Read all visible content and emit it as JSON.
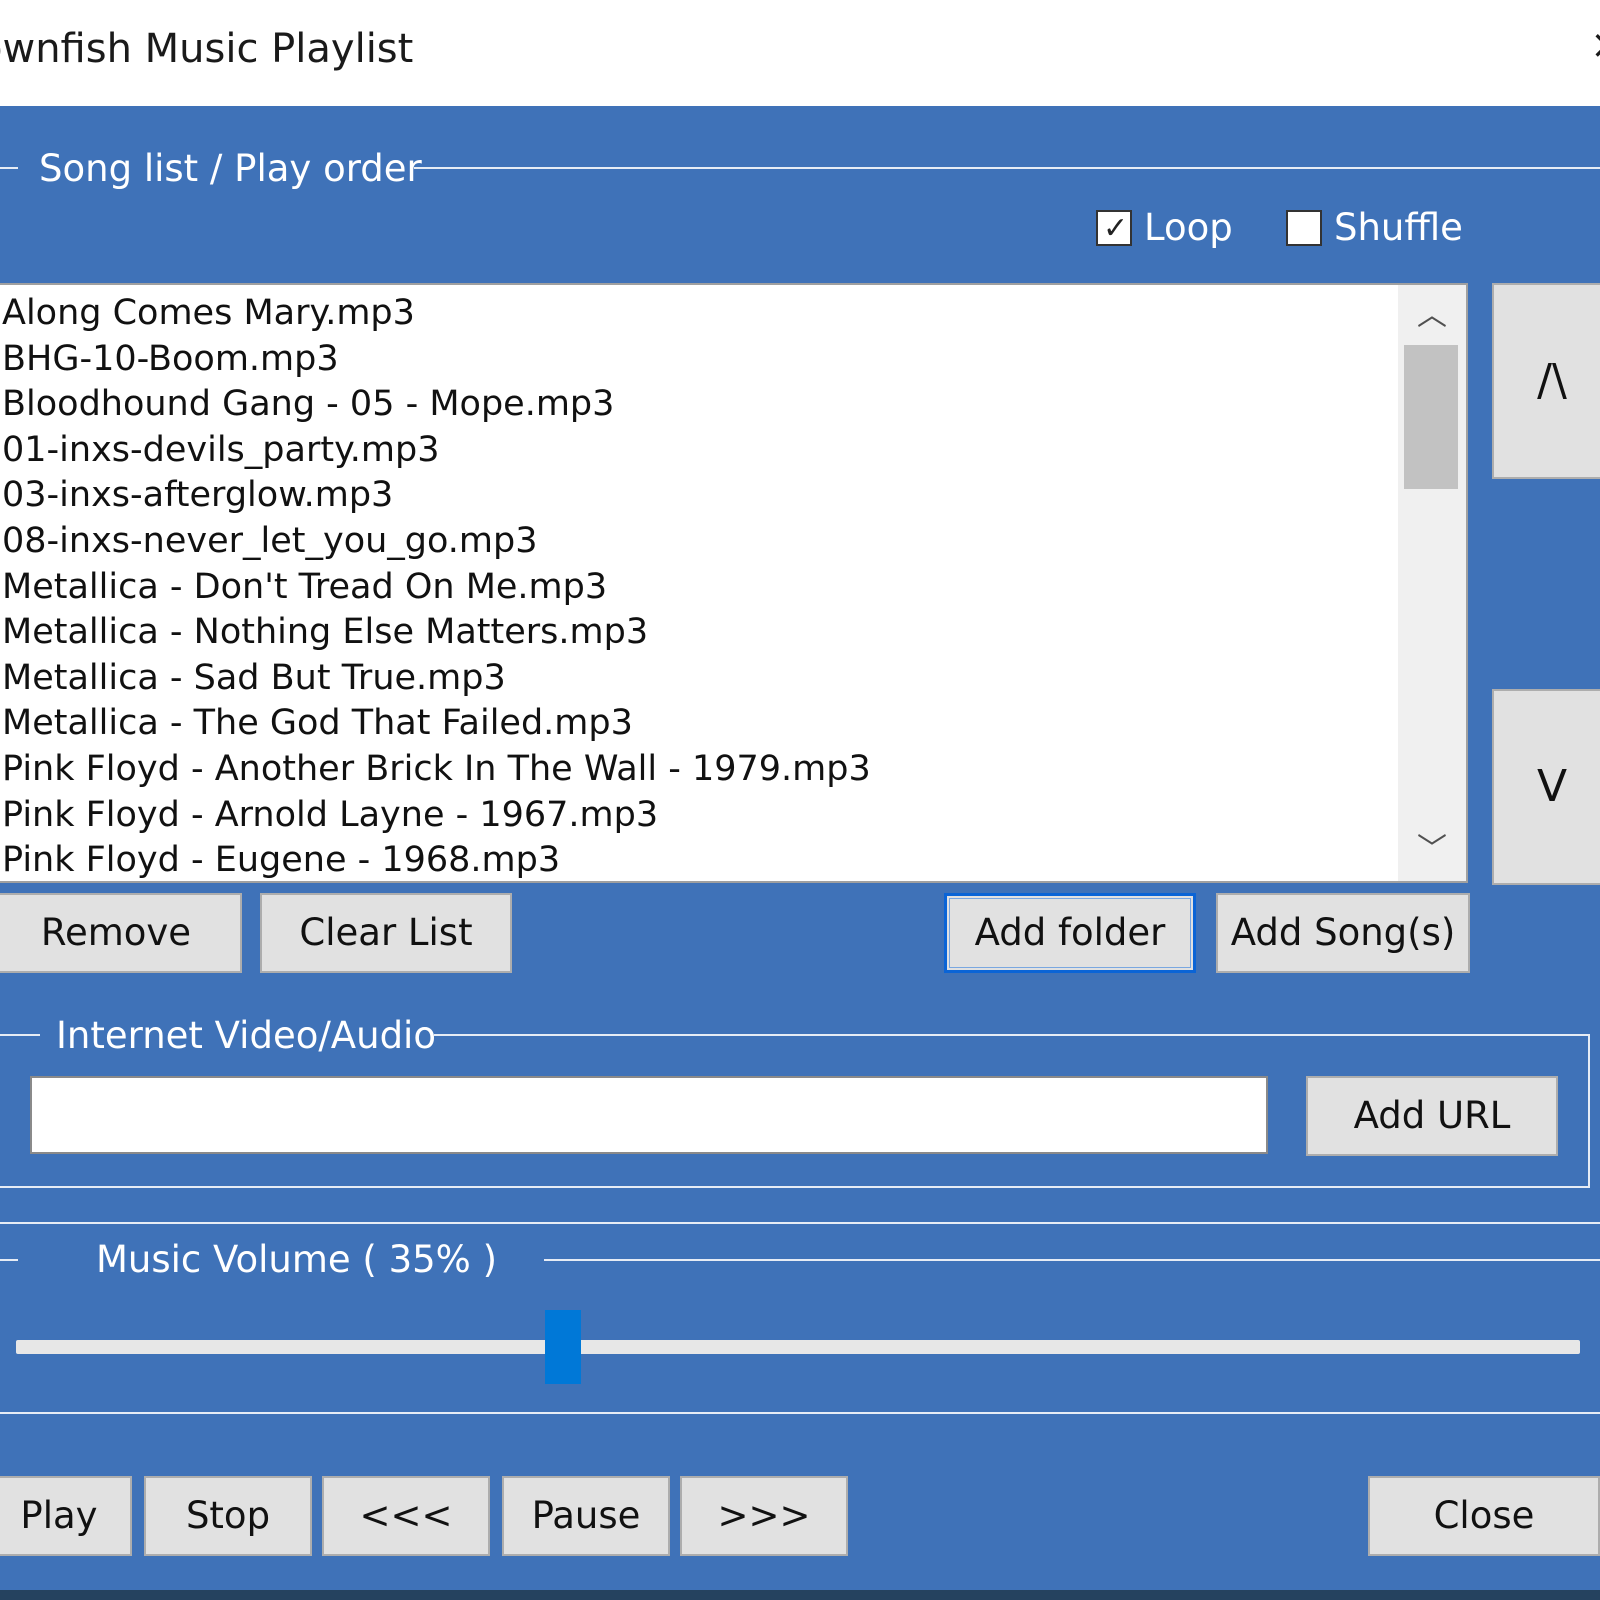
{
  "window": {
    "title": "ownfish Music Playlist",
    "close_glyph": "×"
  },
  "song_group": {
    "label": "Song list / Play order",
    "loop": {
      "label": "Loop",
      "checked": true
    },
    "shuffle": {
      "label": "Shuffle",
      "checked": false
    },
    "songs": [
      "Along Comes Mary.mp3",
      "BHG-10-Boom.mp3",
      "Bloodhound Gang - 05 - Mope.mp3",
      "01-inxs-devils_party.mp3",
      "03-inxs-afterglow.mp3",
      "08-inxs-never_let_you_go.mp3",
      "Metallica - Don't Tread On Me.mp3",
      "Metallica - Nothing Else Matters.mp3",
      "Metallica - Sad But True.mp3",
      "Metallica - The God That Failed.mp3",
      "Pink Floyd - Another Brick In The Wall - 1979.mp3",
      "Pink Floyd - Arnold Layne - 1967.mp3",
      "Pink Floyd - Eugene - 1968.mp3"
    ],
    "scroll_up_glyph": "︿",
    "scroll_down_glyph": "﹀",
    "move_up_label": "/\\",
    "move_down_label": "V",
    "remove_label": "Remove",
    "clear_label": "Clear List",
    "add_folder_label": "Add folder",
    "add_songs_label": "Add Song(s)"
  },
  "internet_group": {
    "label": "Internet Video/Audio",
    "url_value": "",
    "add_url_label": "Add URL"
  },
  "volume_group": {
    "label": "Music Volume ( 35% )",
    "value_fraction": 0.35
  },
  "transport": {
    "play_label": "Play",
    "stop_label": "Stop",
    "prev_label": "<<<",
    "pause_label": "Pause",
    "next_label": ">>>",
    "close_label": "Close"
  },
  "colors": {
    "background": "#3f72b8",
    "accent": "#0078d7"
  }
}
